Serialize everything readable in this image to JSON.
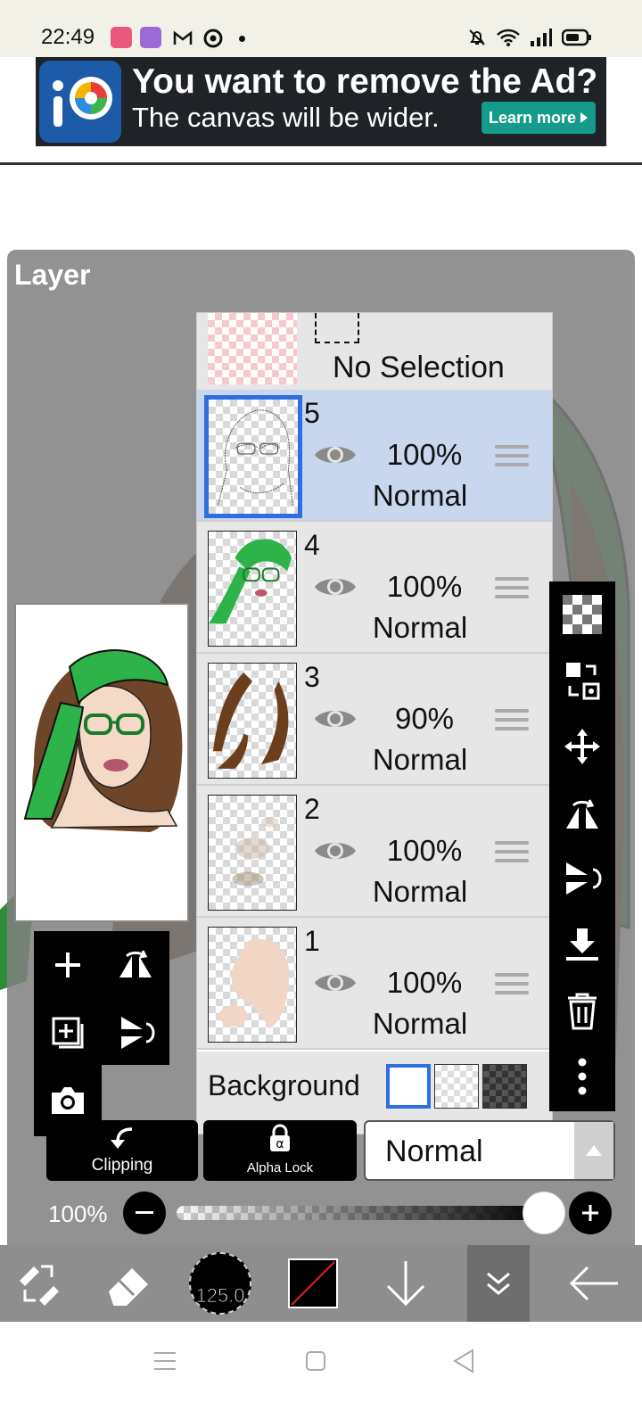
{
  "status": {
    "time": "22:49"
  },
  "ad": {
    "title": "You want to remove the Ad?",
    "subtitle": "The canvas will be wider.",
    "cta": "Learn more"
  },
  "panel": {
    "title": "Layer"
  },
  "selection_layer": {
    "label": "No Selection"
  },
  "layers": [
    {
      "number": "5",
      "opacity": "100%",
      "blend": "Normal",
      "active": true
    },
    {
      "number": "4",
      "opacity": "100%",
      "blend": "Normal",
      "active": false
    },
    {
      "number": "3",
      "opacity": "90%",
      "blend": "Normal",
      "active": false
    },
    {
      "number": "2",
      "opacity": "100%",
      "blend": "Normal",
      "active": false
    },
    {
      "number": "1",
      "opacity": "100%",
      "blend": "Normal",
      "active": false
    }
  ],
  "background": {
    "label": "Background"
  },
  "layer_controls": {
    "clipping": "Clipping",
    "alpha_lock": "Alpha Lock",
    "blend_mode": "Normal"
  },
  "opacity_slider": {
    "label": "100%",
    "value": 1.0
  },
  "toolbar": {
    "brush_size": "125.0"
  },
  "colors": {
    "accent_blue": "#2d6fe0",
    "active_row": "#c8d7ee",
    "ad_button": "#159b8b",
    "green_art": "#2db34a"
  }
}
